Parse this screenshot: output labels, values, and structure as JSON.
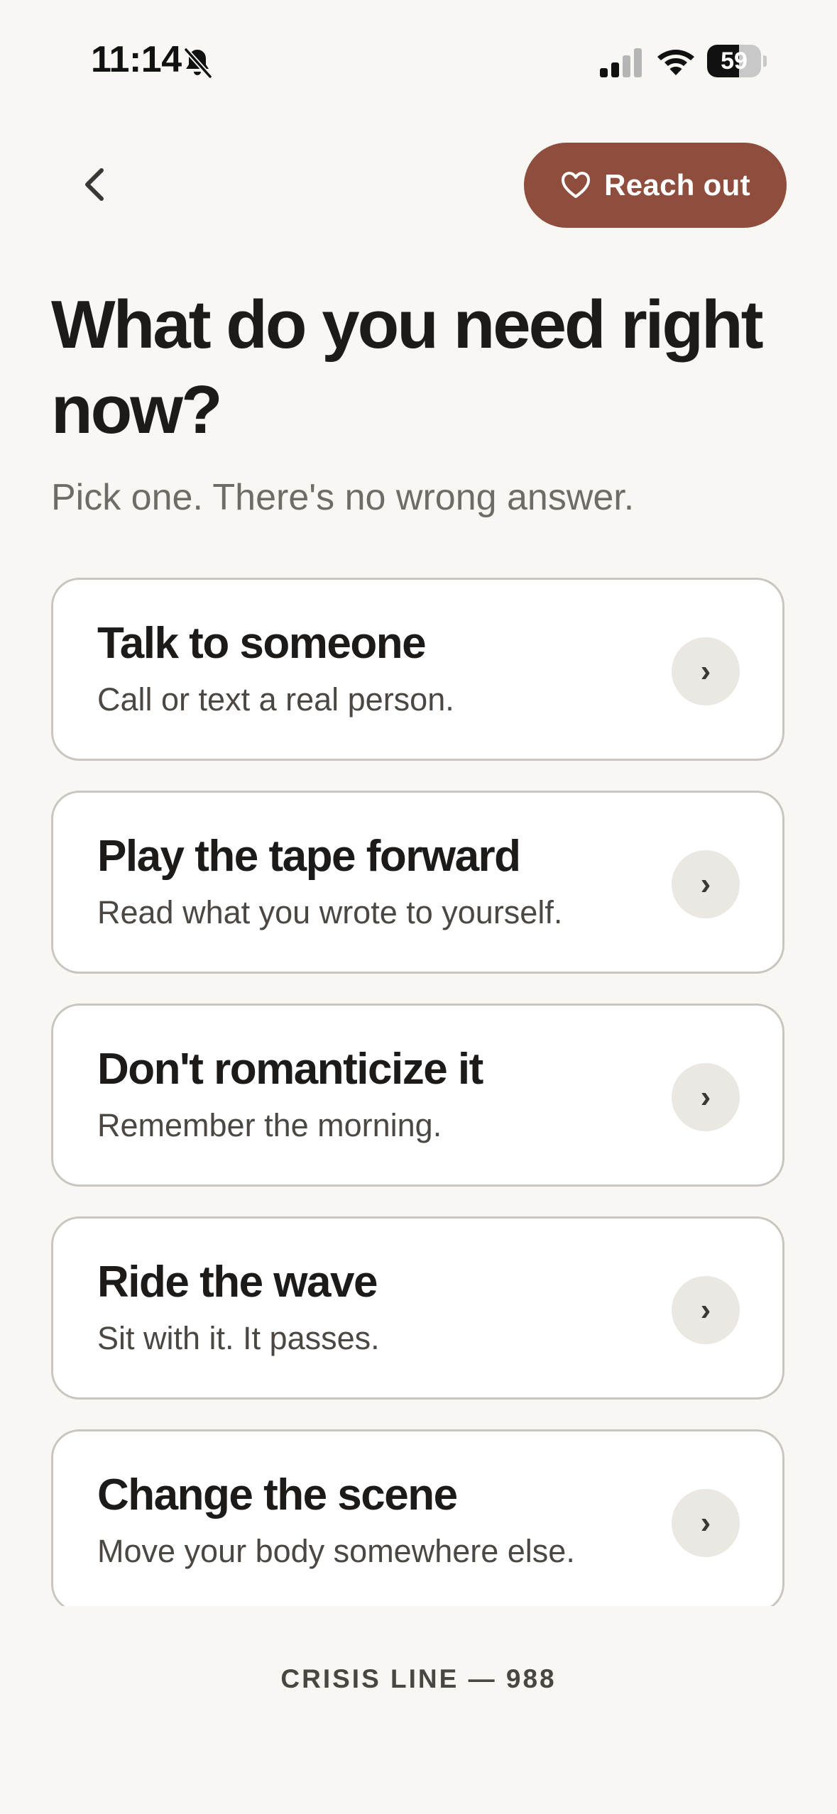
{
  "status_bar": {
    "time": "11:14",
    "battery_level": "59",
    "battery_fraction": 0.59,
    "icons": [
      "bell-slash-icon",
      "cellular-signal-icon",
      "wifi-icon",
      "battery-icon"
    ]
  },
  "header": {
    "back_icon": "chevron-left-icon",
    "reach_out_label": "Reach out",
    "reach_out_icon": "heart-outline-icon"
  },
  "main": {
    "title": "What do you need right now?",
    "subtitle": "Pick one. There's no wrong answer.",
    "options": [
      {
        "title": "Talk to someone",
        "description": "Call or text a real person.",
        "arrow": "›"
      },
      {
        "title": "Play the tape forward",
        "description": "Read what you wrote to yourself.",
        "arrow": "›"
      },
      {
        "title": "Don't romanticize it",
        "description": "Remember the morning.",
        "arrow": "›"
      },
      {
        "title": "Ride the wave",
        "description": "Sit with it. It passes.",
        "arrow": "›"
      },
      {
        "title": "Change the scene",
        "description": "Move your body somewhere else.",
        "arrow": "›"
      }
    ]
  },
  "footer": {
    "crisis_line": "CRISIS LINE — 988"
  },
  "colors": {
    "background": "#f8f7f4",
    "accent": "#8f4d3d",
    "card_border": "#c9c6c0",
    "arrow_chip": "#ebe8e4"
  }
}
